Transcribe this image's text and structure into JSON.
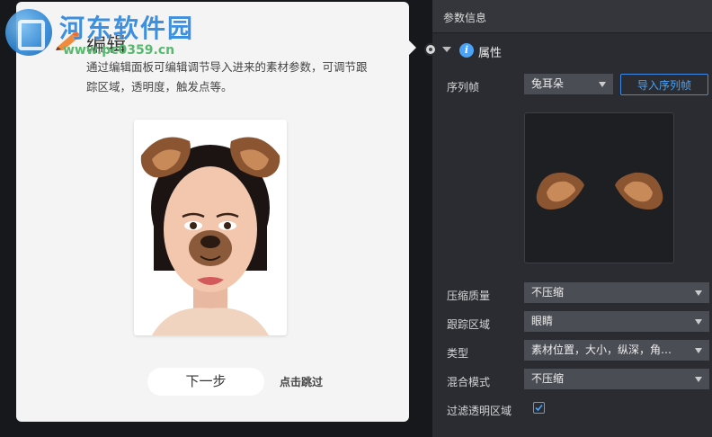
{
  "watermark": {
    "name": "河东软件园",
    "url": "www.pc0359.cn"
  },
  "tutorial": {
    "title": "编辑",
    "description": "通过编辑面板可编辑调节导入进来的素材参数，可调节跟踪区域，透明度，触发点等。",
    "next_label": "下一步",
    "skip_label": "点击跳过"
  },
  "panel": {
    "header_title": "参数信息",
    "section_title": "属性",
    "info_icon_glyph": "i",
    "fields": {
      "sequence_frame": {
        "label": "序列帧",
        "value": "兔耳朵",
        "import_label": "导入序列帧"
      },
      "compression_quality": {
        "label": "压缩质量",
        "value": "不压缩"
      },
      "tracking_area": {
        "label": "跟踪区域",
        "value": "眼睛"
      },
      "type": {
        "label": "类型",
        "value": "素材位置，大小，纵深，角…"
      },
      "blend_mode": {
        "label": "混合模式",
        "value": "不压缩"
      },
      "filter_transparent": {
        "label": "过滤透明区域",
        "checked": true
      }
    }
  },
  "colors": {
    "panel_bg": "#2a2c31",
    "accent": "#4aa3f7",
    "card_bg": "#f4f4f4"
  }
}
